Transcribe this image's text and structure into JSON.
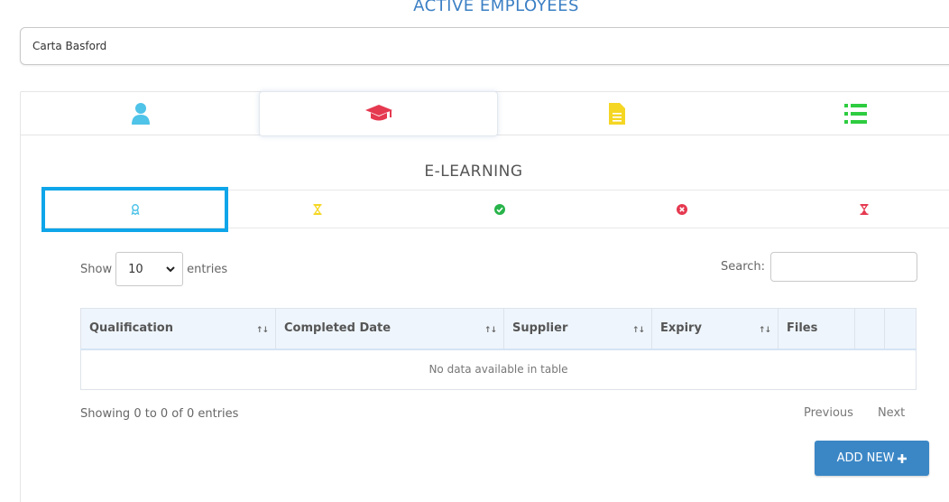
{
  "header": {
    "title": "ACTIVE EMPLOYEES"
  },
  "employee_select": {
    "value": "Carta Basford"
  },
  "top_tabs": [
    {
      "icon": "user-icon",
      "color": "#4fc3e8"
    },
    {
      "icon": "graduation-cap-icon",
      "color": "#e53950",
      "active": true
    },
    {
      "icon": "document-icon",
      "color": "#f5d623"
    },
    {
      "icon": "list-icon",
      "color": "#2ecc40"
    }
  ],
  "section": {
    "title": "E-LEARNING"
  },
  "sub_tabs": [
    {
      "icon": "award-icon",
      "color": "#4fc3e8",
      "active": true
    },
    {
      "icon": "hourglass-icon",
      "color": "#f5d623"
    },
    {
      "icon": "check-circle-icon",
      "color": "#28b44a"
    },
    {
      "icon": "times-circle-icon",
      "color": "#e53950"
    },
    {
      "icon": "hourglass-end-icon",
      "color": "#e53950"
    }
  ],
  "table_controls": {
    "show_label": "Show",
    "entries_value": "10",
    "entries_label": "entries",
    "search_label": "Search:",
    "search_value": ""
  },
  "table": {
    "columns": [
      "Qualification",
      "Completed Date",
      "Supplier",
      "Expiry",
      "Files",
      "",
      ""
    ],
    "empty_message": "No data available in table"
  },
  "footer": {
    "info": "Showing 0 to 0 of 0 entries",
    "previous": "Previous",
    "next": "Next",
    "add_new": "ADD NEW"
  },
  "colors": {
    "accent": "#3b87c6",
    "title": "#3b7fc4",
    "active_outline": "#0ea5e9"
  }
}
